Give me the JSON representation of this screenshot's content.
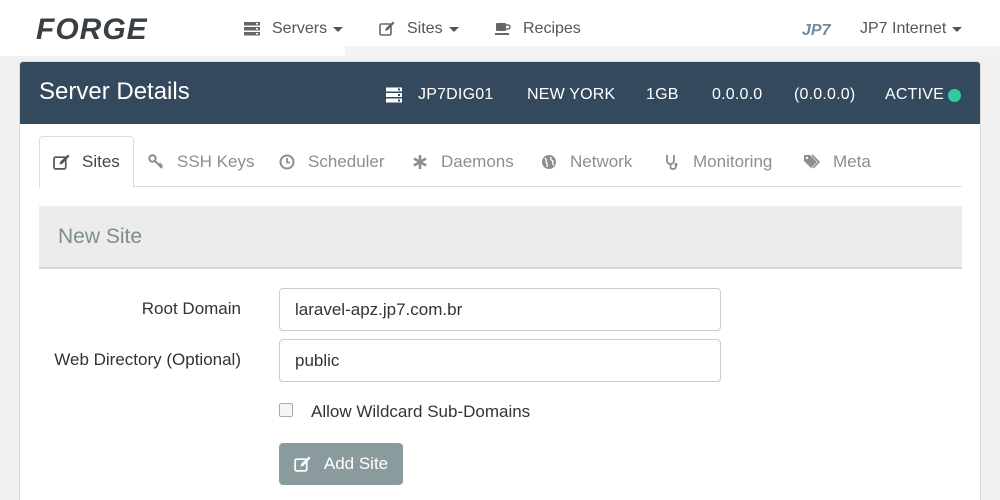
{
  "brand": {
    "logo_text": "FORGE"
  },
  "topnav": {
    "servers_label": "Servers",
    "sites_label": "Sites",
    "recipes_label": "Recipes",
    "user_logo_text": "JP7",
    "user_label": "JP7 Internet"
  },
  "header": {
    "title": "Server Details",
    "server_name": "JP7DIG01",
    "location": "NEW YORK",
    "size": "1GB",
    "ip": "0.0.0.0",
    "private_ip": "(0.0.0.0)",
    "status": "ACTIVE"
  },
  "tabs": [
    {
      "label": "Sites",
      "icon": "edit-icon"
    },
    {
      "label": "SSH Keys",
      "icon": "key-icon"
    },
    {
      "label": "Scheduler",
      "icon": "clock-icon"
    },
    {
      "label": "Daemons",
      "icon": "asterisk-icon"
    },
    {
      "label": "Network",
      "icon": "globe-icon"
    },
    {
      "label": "Monitoring",
      "icon": "stethoscope-icon"
    },
    {
      "label": "Meta",
      "icon": "tags-icon"
    }
  ],
  "new_site": {
    "title": "New Site",
    "root_domain_label": "Root Domain",
    "root_domain_value": "laravel-apz.jp7.com.br",
    "web_dir_label": "Web Directory (Optional)",
    "web_dir_value": "public",
    "wildcard_label": "Allow Wildcard Sub-Domains",
    "add_button": "Add Site"
  },
  "colors": {
    "header_bg": "#34495e",
    "status_active": "#2ecc9a",
    "button_bg": "#8a9b9e"
  }
}
